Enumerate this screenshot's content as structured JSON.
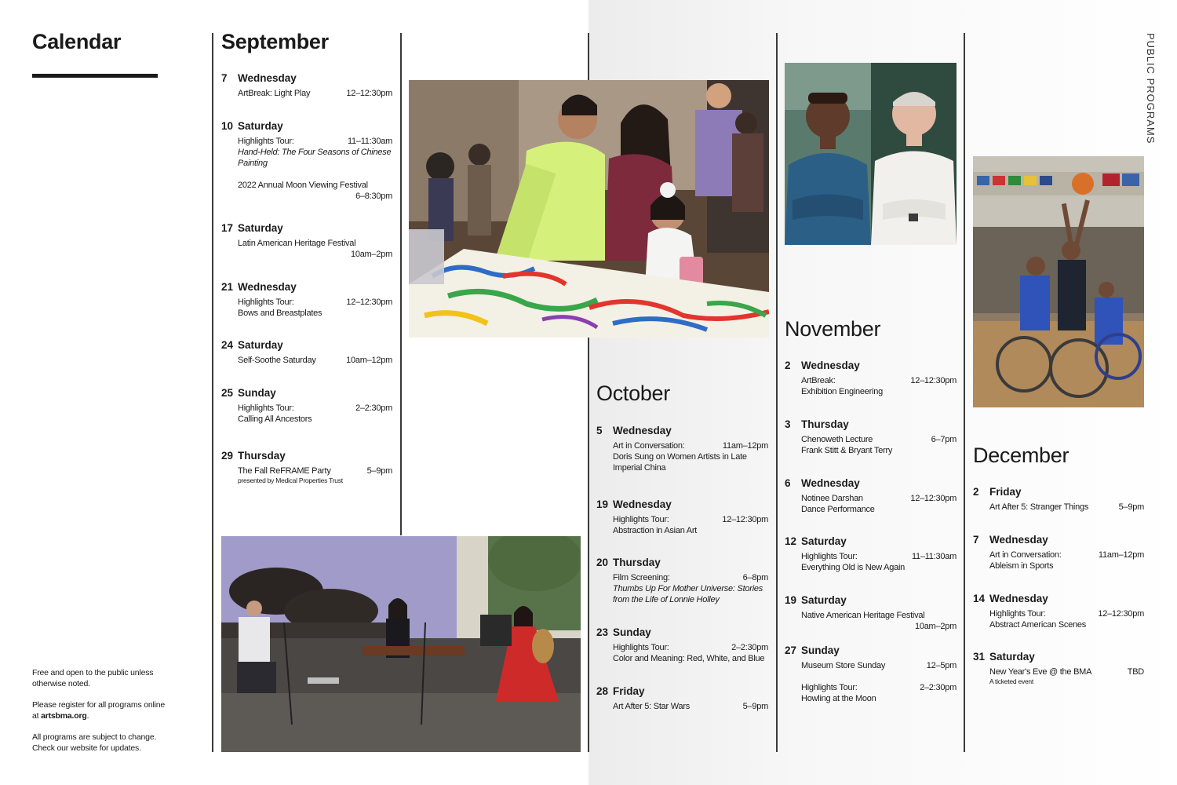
{
  "page": {
    "title": "Calendar",
    "section_label": "PUBLIC PROGRAMS",
    "footer": {
      "line1": "Free and open to the public unless otherwise noted.",
      "line2_prefix": "Please register for all programs online at ",
      "line2_link": "artsbma.org",
      "line2_suffix": ".",
      "line3": "All programs are subject to change. Check our website for updates."
    }
  },
  "months": {
    "september": {
      "name": "September",
      "events": [
        {
          "day": "7",
          "weekday": "Wednesday",
          "title": "ArtBreak: Light Play",
          "time": "12–12:30pm"
        },
        {
          "day": "10",
          "weekday": "Saturday",
          "title": "Highlights Tour:",
          "time": "11–11:30am",
          "subtitle": "Hand-Held: The Four Seasons of Chinese Painting",
          "title2": "2022 Annual Moon Viewing Festival",
          "time2": "6–8:30pm"
        },
        {
          "day": "17",
          "weekday": "Saturday",
          "title": "Latin American Heritage Festival",
          "time": "10am–2pm"
        },
        {
          "day": "21",
          "weekday": "Wednesday",
          "title": "Highlights Tour:",
          "time": "12–12:30pm",
          "subtitle": "Bows and Breastplates"
        },
        {
          "day": "24",
          "weekday": "Saturday",
          "title": "Self-Soothe Saturday",
          "time": "10am–12pm"
        },
        {
          "day": "25",
          "weekday": "Sunday",
          "title": "Highlights Tour:",
          "time": "2–2:30pm",
          "subtitle": "Calling All Ancestors"
        },
        {
          "day": "29",
          "weekday": "Thursday",
          "title": "The Fall ReFRAME Party",
          "time": "5–9pm",
          "note": "presented by Medical Properties Trust"
        }
      ]
    },
    "october": {
      "name": "October",
      "events": [
        {
          "day": "5",
          "weekday": "Wednesday",
          "title": "Art in Conversation:",
          "time": "11am–12pm",
          "subtitle": "Doris Sung on Women Artists in Late Imperial China"
        },
        {
          "day": "19",
          "weekday": "Wednesday",
          "title": "Highlights Tour:",
          "time": "12–12:30pm",
          "subtitle": "Abstraction in Asian Art"
        },
        {
          "day": "20",
          "weekday": "Thursday",
          "title": "Film Screening:",
          "time": "6–8pm",
          "subtitle": "Thumbs Up For Mother Universe: Stories from the Life of Lonnie Holley"
        },
        {
          "day": "23",
          "weekday": "Sunday",
          "title": "Highlights Tour:",
          "time": "2–2:30pm",
          "subtitle": "Color and Meaning: Red, White, and Blue"
        },
        {
          "day": "28",
          "weekday": "Friday",
          "title": "Art After 5: Star Wars",
          "time": "5–9pm"
        }
      ]
    },
    "november": {
      "name": "November",
      "events": [
        {
          "day": "2",
          "weekday": "Wednesday",
          "title": "ArtBreak:",
          "time": "12–12:30pm",
          "subtitle": "Exhibition Engineering"
        },
        {
          "day": "3",
          "weekday": "Thursday",
          "title": "Chenoweth Lecture",
          "time": "6–7pm",
          "subtitle": "Frank Stitt & Bryant Terry"
        },
        {
          "day": "6",
          "weekday": "Wednesday",
          "title": "Notinee Darshan",
          "time": "12–12:30pm",
          "subtitle": "Dance Performance"
        },
        {
          "day": "12",
          "weekday": "Saturday",
          "title": "Highlights Tour:",
          "time": "11–11:30am",
          "subtitle": "Everything Old is New Again"
        },
        {
          "day": "19",
          "weekday": "Saturday",
          "title": "Native American Heritage Festival",
          "time": "10am–2pm"
        },
        {
          "day": "27",
          "weekday": "Sunday",
          "title": "Museum Store Sunday",
          "time": "12–5pm",
          "title2": "Highlights Tour:",
          "time2": "2–2:30pm",
          "subtitle2": "Howling at the Moon"
        }
      ]
    },
    "december": {
      "name": "December",
      "events": [
        {
          "day": "2",
          "weekday": "Friday",
          "title": "Art After 5: Stranger Things",
          "time": "5–9pm"
        },
        {
          "day": "7",
          "weekday": "Wednesday",
          "title": "Art in Conversation:",
          "time": "11am–12pm",
          "subtitle": "Ableism in Sports"
        },
        {
          "day": "14",
          "weekday": "Wednesday",
          "title": "Highlights Tour:",
          "time": "12–12:30pm",
          "subtitle": "Abstract American Scenes"
        },
        {
          "day": "31",
          "weekday": "Saturday",
          "title": "New Year's Eve @ the BMA",
          "time": "TBD",
          "note": "A ticketed event"
        }
      ]
    }
  }
}
